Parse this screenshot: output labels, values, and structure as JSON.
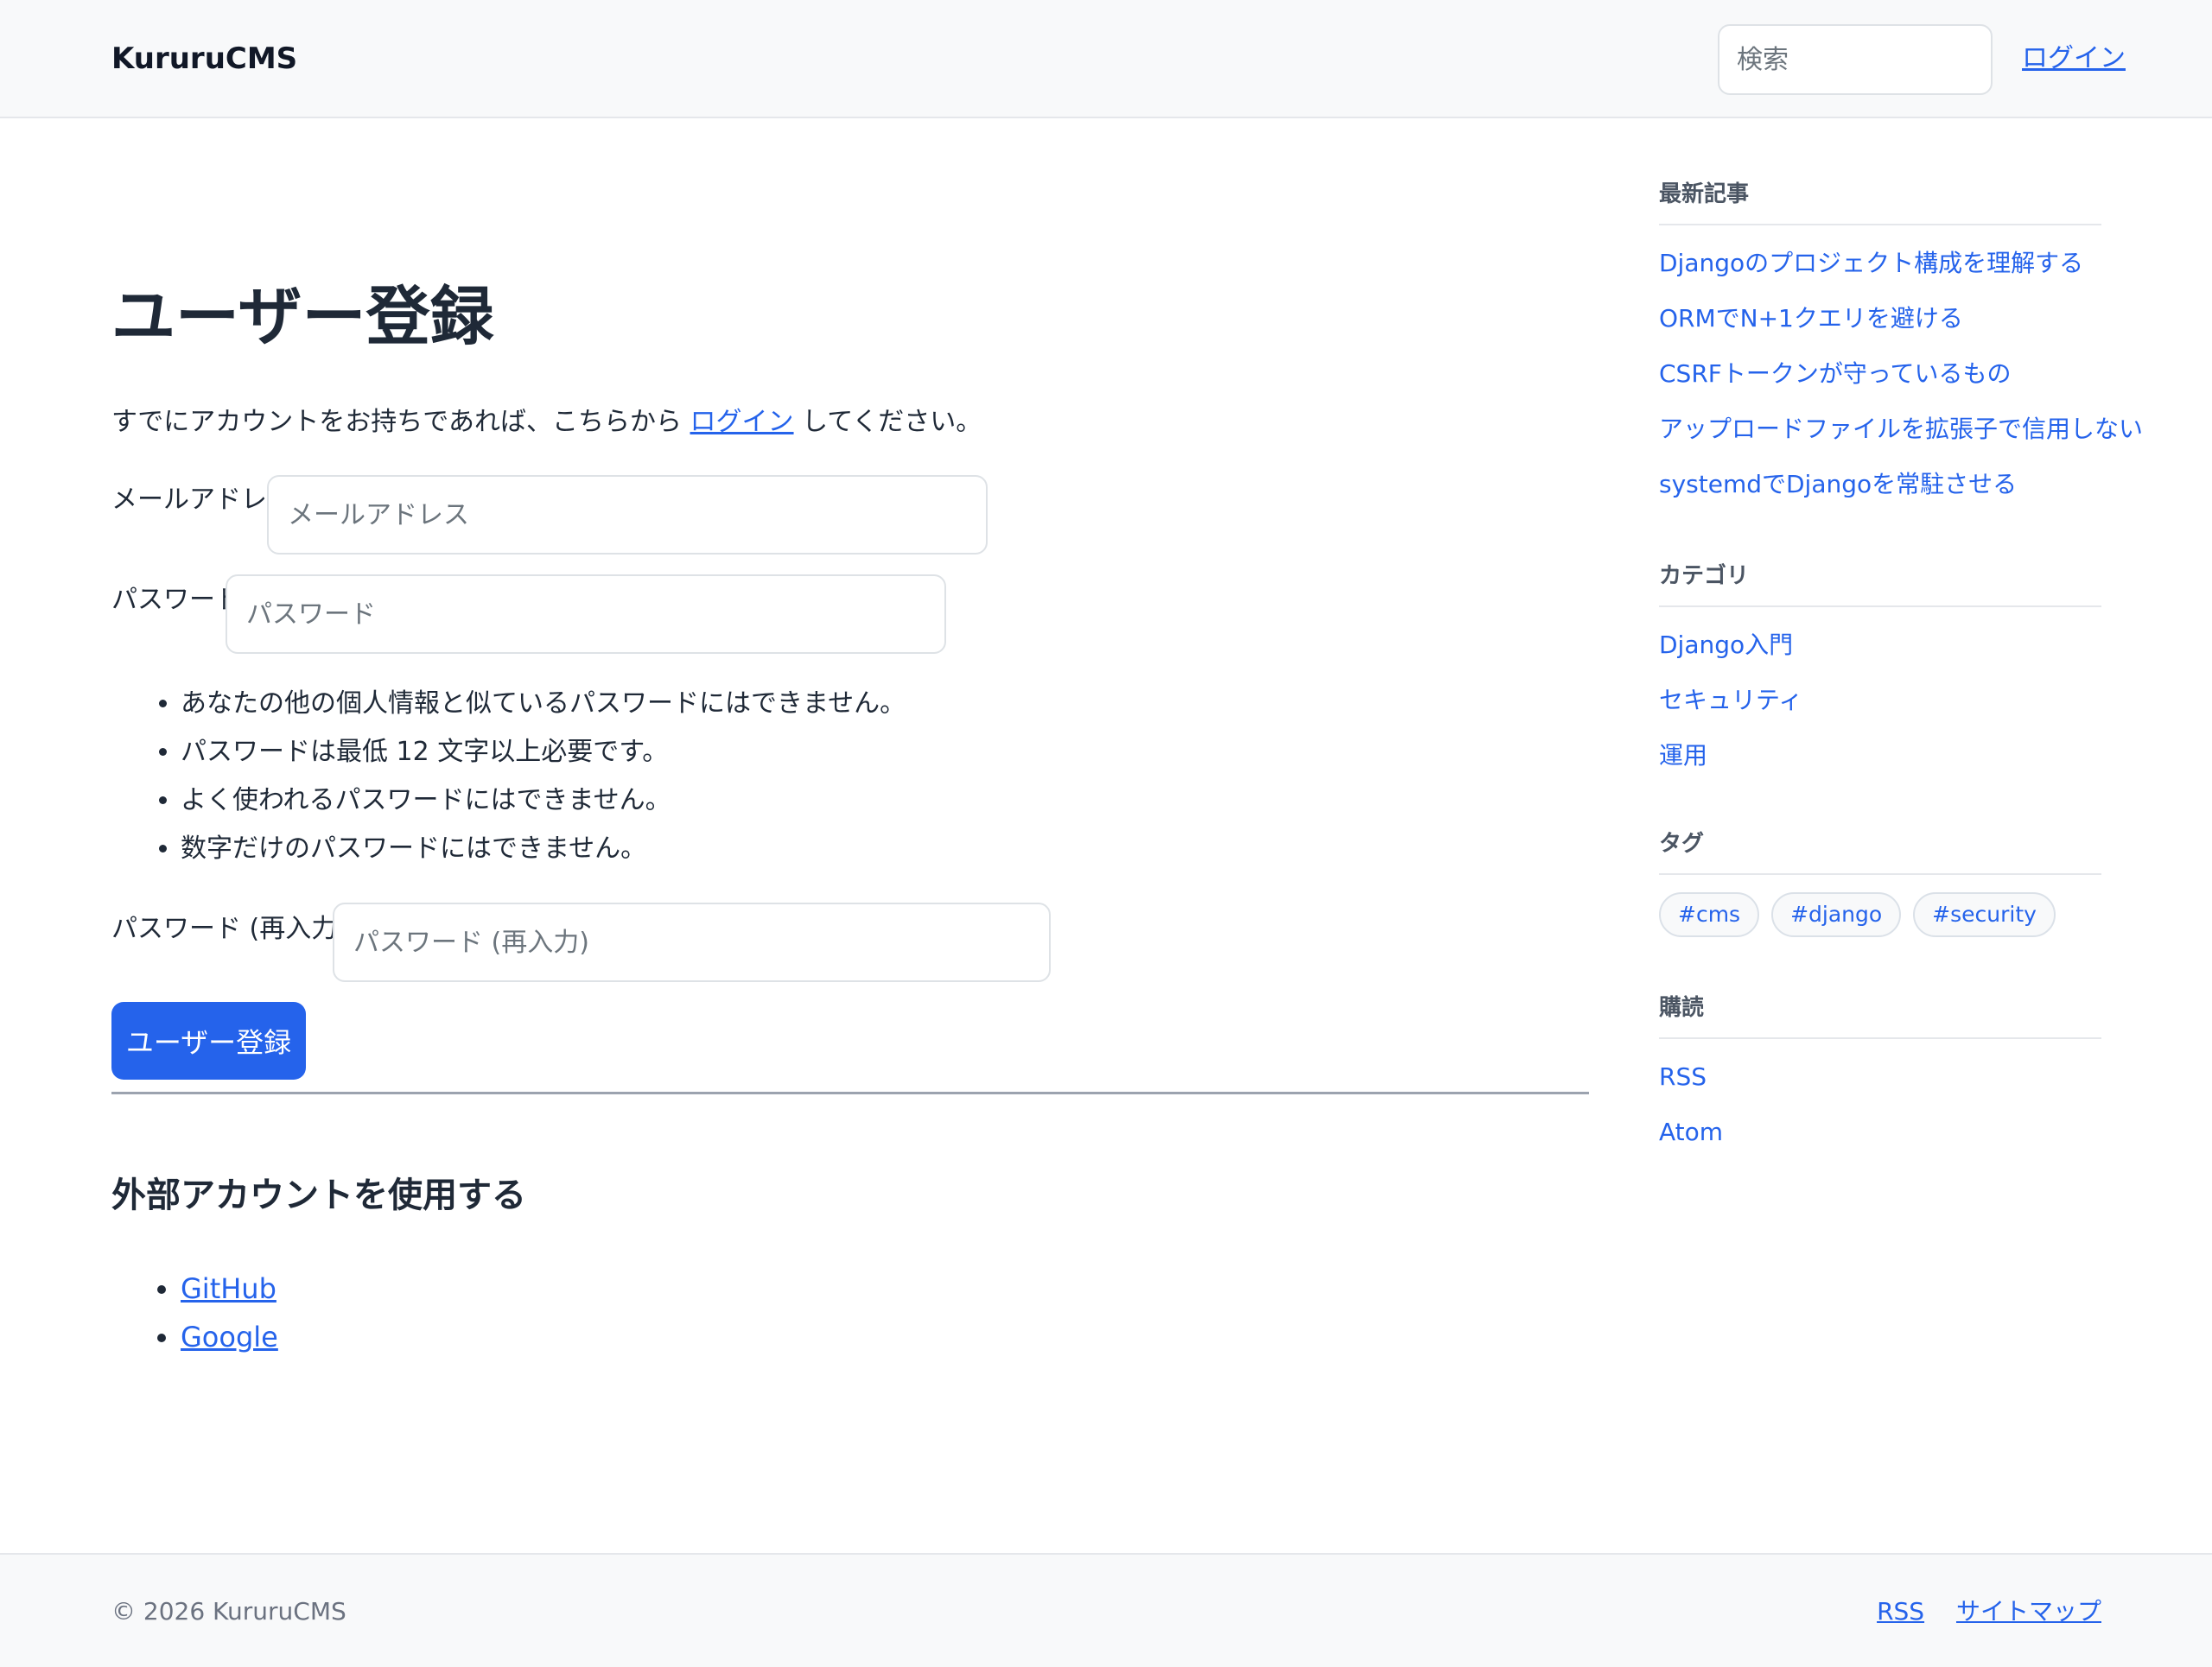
{
  "header": {
    "brand": "KururuCMS",
    "search_placeholder": "検索",
    "login_label": "ログイン"
  },
  "main": {
    "title": "ユーザー登録",
    "intro_before": "すでにアカウントをお持ちであれば、こちらから",
    "intro_link": "ログイン",
    "intro_after": "してください。",
    "form": {
      "email_label": "メールアドレス:",
      "email_placeholder": "メールアドレス",
      "password_label": "パスワード:",
      "password_placeholder": "パスワード",
      "password_help": [
        "あなたの他の個人情報と似ているパスワードにはできません。",
        "パスワードは最低 12 文字以上必要です。",
        "よく使われるパスワードにはできません。",
        "数字だけのパスワードにはできません。"
      ],
      "password2_label": "パスワード (再入力):",
      "password2_placeholder": "パスワード (再入力)",
      "submit_label": "ユーザー登録"
    },
    "social": {
      "title": "外部アカウントを使用する",
      "providers": [
        "GitHub",
        "Google"
      ]
    }
  },
  "sidebar": {
    "recent": {
      "title": "最新記事",
      "items": [
        "Djangoのプロジェクト構成を理解する",
        "ORMでN+1クエリを避ける",
        "CSRFトークンが守っているもの",
        "アップロードファイルを拡張子で信用しない",
        "systemdでDjangoを常駐させる"
      ]
    },
    "categories": {
      "title": "カテゴリ",
      "items": [
        "Django入門",
        "セキュリティ",
        "運用"
      ]
    },
    "tags": {
      "title": "タグ",
      "items": [
        "#cms",
        "#django",
        "#security"
      ]
    },
    "subscribe": {
      "title": "購読",
      "items": [
        "RSS",
        "Atom"
      ]
    }
  },
  "footer": {
    "copyright": "© 2026 KururuCMS",
    "links": [
      "RSS",
      "サイトマップ"
    ]
  }
}
